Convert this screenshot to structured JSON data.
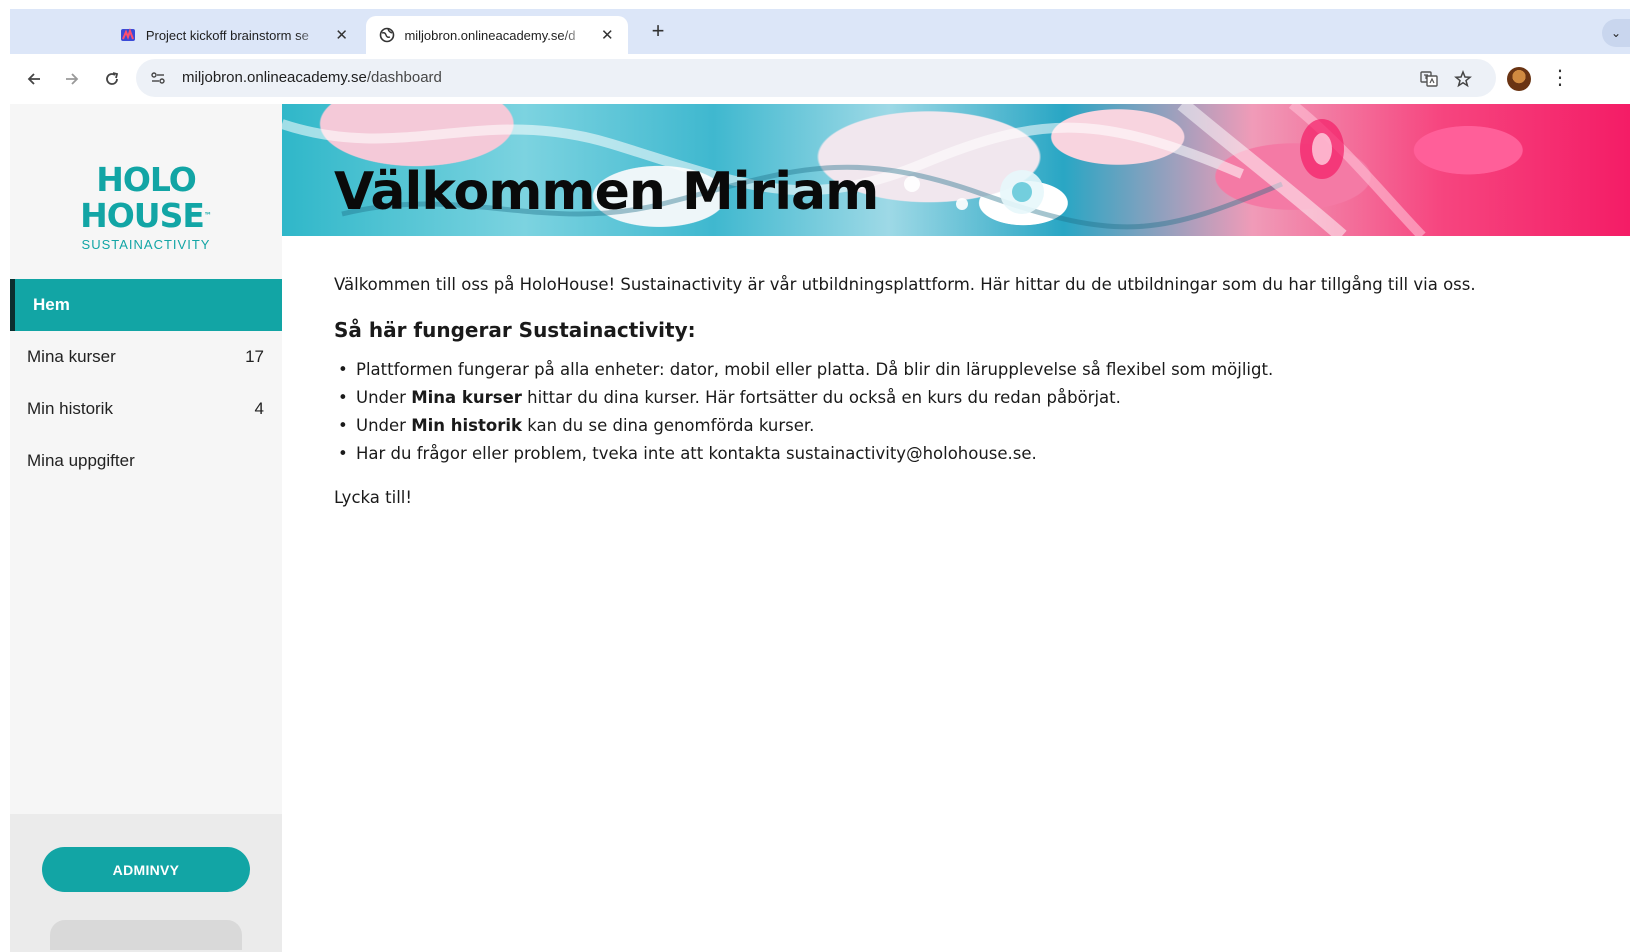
{
  "browser": {
    "tabs": [
      {
        "title": "Project kickoff brainstorm se",
        "close": "✕"
      },
      {
        "title": "miljobron.onlineacademy.se/d",
        "close": "✕"
      }
    ],
    "new_tab": "+",
    "tab_menu": "⌄",
    "url_host": "miljobron.onlineacademy.se",
    "url_path": "/dashboard"
  },
  "sidebar": {
    "logo": "HOLO HOUSE",
    "logo_tm": "™",
    "logo_sub": "SUSTAINACTIVITY",
    "items": [
      {
        "label": "Hem",
        "count": ""
      },
      {
        "label": "Mina kurser",
        "count": "17"
      },
      {
        "label": "Min historik",
        "count": "4"
      },
      {
        "label": "Mina uppgifter",
        "count": ""
      }
    ],
    "admin_button": "ADMINVY"
  },
  "hero": {
    "title": "Välkommen Miriam"
  },
  "main": {
    "intro": "Välkommen till oss på HoloHouse! Sustainactivity är vår utbildningsplattform. Här hittar du de utbildningar som du har tillgång till via oss.",
    "howto_heading": "Så här fungerar Sustainactivity:",
    "bullet1": "Plattformen fungerar på alla enheter: dator, mobil eller platta. Då blir din lärupplevelse så flexibel som möjligt.",
    "bullet2_pre": "Under ",
    "bullet2_bold": "Mina kurser",
    "bullet2_post": " hittar du dina kurser. Här fortsätter du också en kurs du redan påbörjat.",
    "bullet3_pre": "Under ",
    "bullet3_bold": "Min historik",
    "bullet3_post": " kan du se dina genomförda kurser.",
    "bullet4": "Har du frågor eller problem, tveka inte att kontakta sustainactivity@holohouse.se.",
    "closing": "Lycka till!"
  },
  "colors": {
    "brand": "#12a5a5",
    "tabbar": "#dce6f8"
  }
}
